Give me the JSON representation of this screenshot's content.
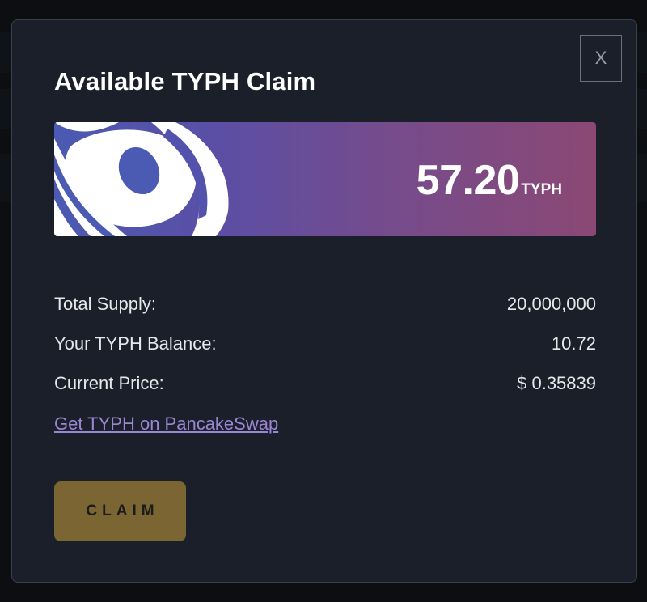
{
  "modal": {
    "close_label": "X",
    "title": "Available TYPH Claim",
    "banner": {
      "amount": "57.20",
      "unit": "TYPH"
    },
    "stats": [
      {
        "label": "Total Supply:",
        "value": "20,000,000"
      },
      {
        "label": "Your TYPH Balance:",
        "value": "10.72"
      },
      {
        "label": "Current Price:",
        "value": "$ 0.35839"
      }
    ],
    "link_text": "Get TYPH on PancakeSwap",
    "claim_label": "CLAIM"
  },
  "colors": {
    "modal_bg": "#1b1f29",
    "banner_start": "#4b5ab2",
    "banner_end": "#8b4874",
    "link": "#9b86d4",
    "claim_button": "#7a6533"
  },
  "icons": [
    "close-icon",
    "typhoon-logo-icon"
  ]
}
